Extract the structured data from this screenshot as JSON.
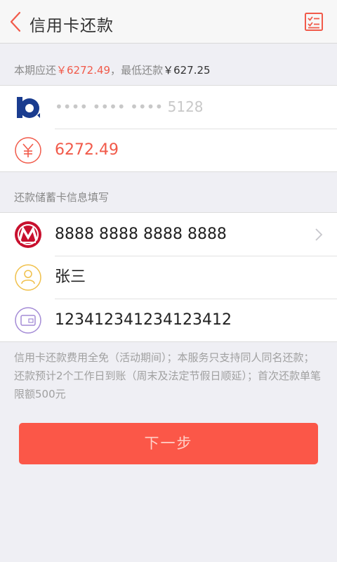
{
  "header": {
    "title": "信用卡还款",
    "back_icon": "chevron-left-icon",
    "record_icon": "list-check-icon",
    "accent_color": "#f15a4a"
  },
  "summary": {
    "due_label": "本期应还",
    "due_amount": "￥6272.49",
    "separator": "，",
    "min_label": "最低还款",
    "min_amount": "￥627.25"
  },
  "credit_card": {
    "bank_icon": "bank-logo-icon",
    "card_number": "•••• •••• •••• 5128",
    "amount_icon": "yuan-icon",
    "amount": "6272.49"
  },
  "debit_section_label": "还款储蓄卡信息填写",
  "debit_card": {
    "bank_icon": "merchants-bank-logo-icon",
    "card_number": "8888 8888 8888 8888",
    "name_icon": "user-icon",
    "name": "张三",
    "id_icon": "id-card-icon",
    "id_number": "123412341234123412"
  },
  "notice": "信用卡还款费用全免（活动期间）；本服务只支持同人同名还款；还款预计2个工作日到账（周末及法定节假日顺延）；首次还款单笔限额500元",
  "next_button": "下一步"
}
